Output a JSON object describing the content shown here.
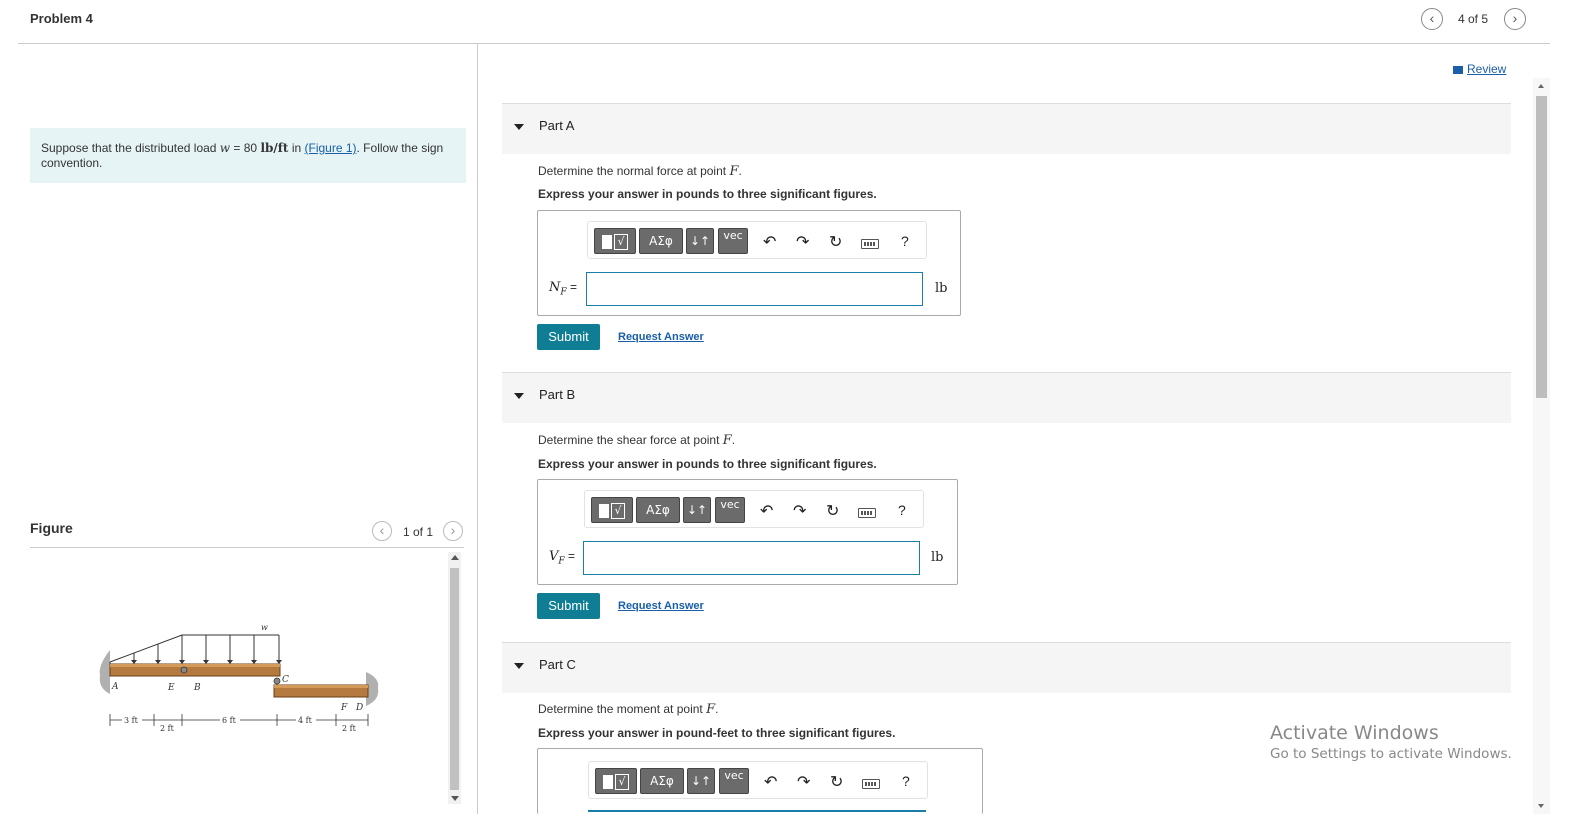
{
  "header": {
    "title": "Problem 4",
    "pager": "4 of 5",
    "prev_icon": "chevron-left-icon",
    "next_icon": "chevron-right-icon"
  },
  "intro": {
    "text_before": "Suppose that the distributed load ",
    "var": "w",
    "eq": " = 80 ",
    "unit": "lb/ft",
    "text_in": " in ",
    "figure_link": "(Figure 1)",
    "text_after": ". Follow the sign convention."
  },
  "figure": {
    "label": "Figure",
    "pager": "1 of 1",
    "diagram": {
      "load_label": "w",
      "points": [
        "A",
        "E",
        "B",
        "C",
        "F",
        "D"
      ],
      "dims": [
        "3 ft",
        "2 ft",
        "6 ft",
        "4 ft",
        "2 ft"
      ]
    }
  },
  "review": {
    "label": "Review",
    "icon": "book-icon"
  },
  "parts": [
    {
      "title": "Part A",
      "question_before": "Determine the normal force at point ",
      "question_var": "F",
      "question_after": ".",
      "instruction": "Express your answer in pounds to three significant figures.",
      "var_main": "N",
      "var_sub": "F",
      "eq": " =",
      "value": "",
      "unit": "lb",
      "submit": "Submit",
      "request": "Request Answer"
    },
    {
      "title": "Part B",
      "question_before": "Determine the shear force at point ",
      "question_var": "F",
      "question_after": ".",
      "instruction": "Express your answer in pounds to three significant figures.",
      "var_main": "V",
      "var_sub": "F",
      "eq": " =",
      "value": "",
      "unit": "lb",
      "submit": "Submit",
      "request": "Request Answer"
    },
    {
      "title": "Part C",
      "question_before": "Determine the moment at point ",
      "question_var": "F",
      "question_after": ".",
      "instruction": "Express your answer in pound-feet to three significant figures."
    }
  ],
  "toolbar": {
    "template": "√",
    "greek": "ΑΣφ",
    "arrows": "↓↑",
    "vec": "vec",
    "help": "?",
    "undo_icon": "undo-icon",
    "redo_icon": "redo-icon",
    "reset_icon": "reset-icon",
    "keyboard_icon": "keyboard-icon"
  },
  "watermark": {
    "line1": "Activate Windows",
    "line2": "Go to Settings to activate Windows."
  }
}
